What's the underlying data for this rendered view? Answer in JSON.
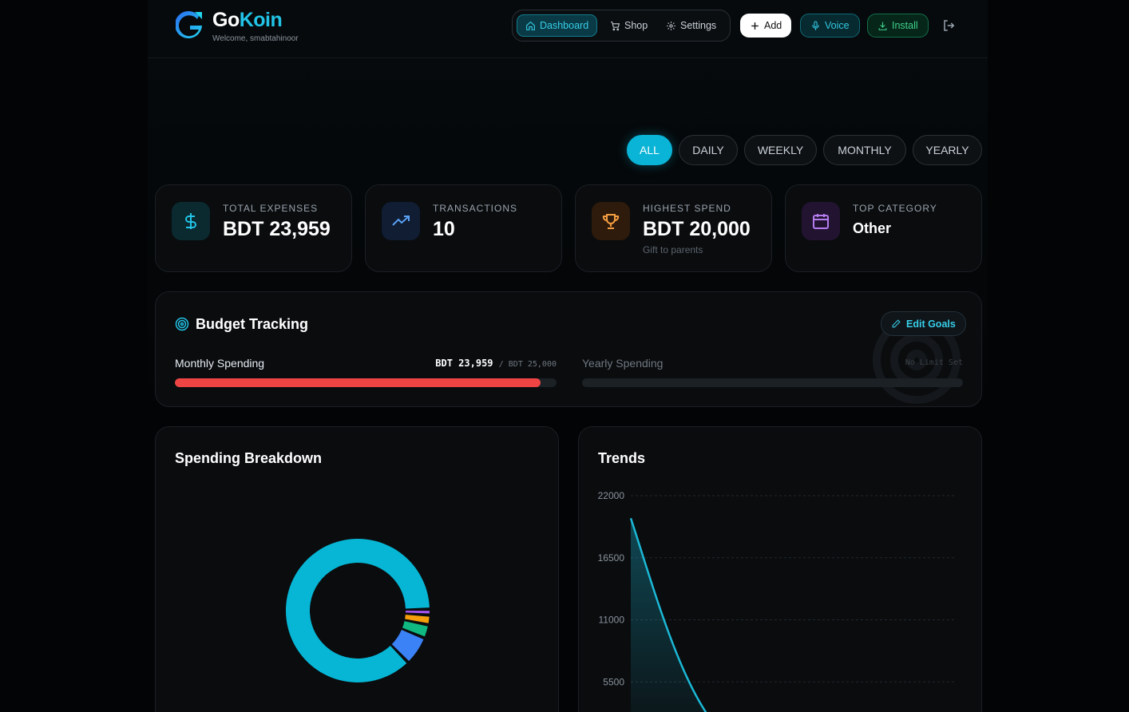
{
  "app": {
    "brand_go": "Go",
    "brand_koin": "Koin",
    "welcome": "Welcome, smabtahinoor"
  },
  "nav": {
    "items": [
      {
        "label": "Dashboard",
        "icon": "home-icon",
        "active": true
      },
      {
        "label": "Shop",
        "icon": "cart-icon",
        "active": false
      },
      {
        "label": "Settings",
        "icon": "gear-icon",
        "active": false
      }
    ],
    "add_label": "Add",
    "voice_label": "Voice",
    "install_label": "Install"
  },
  "filters": [
    "ALL",
    "DAILY",
    "WEEKLY",
    "MONTHLY",
    "YEARLY"
  ],
  "active_filter": "ALL",
  "stats": [
    {
      "label": "TOTAL EXPENSES",
      "value": "BDT 23,959",
      "icon": "dollar-icon",
      "color": "#22c3e6"
    },
    {
      "label": "TRANSACTIONS",
      "value": "10",
      "icon": "trending-up-icon",
      "color": "#5aa0f5"
    },
    {
      "label": "HIGHEST SPEND",
      "value": "BDT 20,000",
      "sub": "Gift to parents",
      "icon": "trophy-icon",
      "color": "#f59e42"
    },
    {
      "label": "TOP CATEGORY",
      "value": "Other",
      "icon": "calendar-icon",
      "color": "#b57cf0"
    }
  ],
  "budget": {
    "title": "Budget Tracking",
    "edit_label": "Edit Goals",
    "monthly_label": "Monthly Spending",
    "monthly_amount": "BDT 23,959",
    "monthly_limit": "/ BDT 25,000",
    "monthly_progress": 0.958,
    "yearly_label": "Yearly Spending",
    "yearly_status": "No Limit Set",
    "bar_color": "#ef4444"
  },
  "breakdown": {
    "title": "Spending Breakdown"
  },
  "trends": {
    "title": "Trends"
  },
  "chart_data": [
    {
      "type": "pie",
      "donut": true,
      "values": [
        20000,
        1500,
        700,
        500,
        300
      ],
      "colors": [
        "#06b6d4",
        "#3b82f6",
        "#10b981",
        "#f59e0b",
        "#a855f7"
      ]
    },
    {
      "type": "area",
      "x": [
        0,
        1
      ],
      "y": [
        20000,
        0
      ],
      "ytick_labels": [
        "22000",
        "16500",
        "11000",
        "5500"
      ],
      "ylim": [
        0,
        22000
      ],
      "color": "#1bb8d6"
    }
  ]
}
